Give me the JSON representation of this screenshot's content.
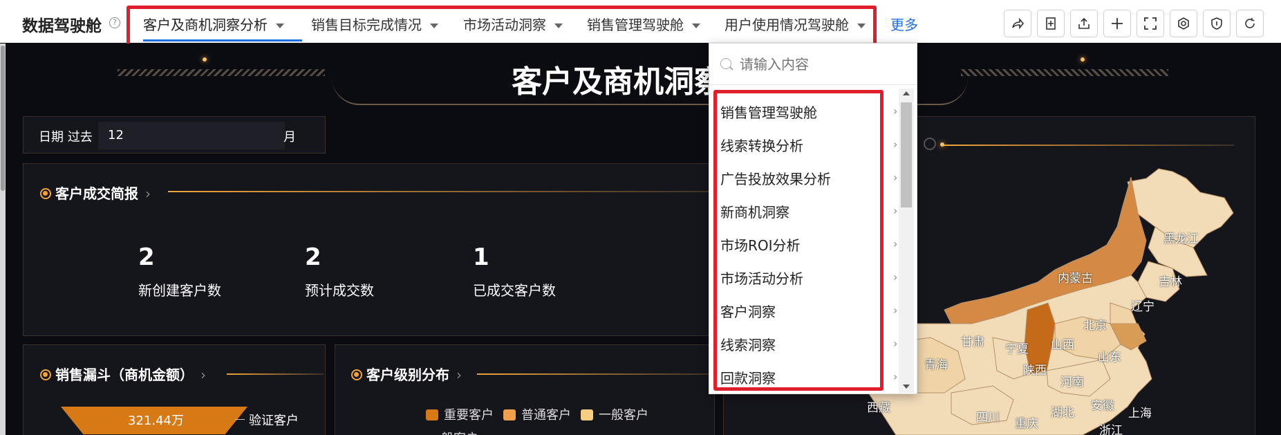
{
  "header": {
    "app_title": "数据驾驶舱",
    "help_glyph": "?",
    "tabs": [
      {
        "label": "客户及商机洞察分析"
      },
      {
        "label": "销售目标完成情况"
      },
      {
        "label": "市场活动洞察"
      },
      {
        "label": "销售管理驾驶舱"
      },
      {
        "label": "用户使用情况驾驶舱"
      }
    ],
    "more_label": "更多",
    "tools": [
      "share-icon",
      "add-page-icon",
      "export-icon",
      "plus-icon",
      "fullscreen-icon",
      "settings-icon",
      "shield-icon",
      "refresh-icon"
    ],
    "accent_color": "#1f6fe5"
  },
  "dashboard": {
    "title": "客户及商机洞察",
    "date_filter": {
      "label": "日期 过去",
      "value": "12",
      "unit": "月"
    },
    "summary": {
      "title": "客户成交简报",
      "kpis": [
        {
          "value": "2",
          "label": "新创建客户数"
        },
        {
          "value": "2",
          "label": "预计成交数"
        },
        {
          "value": "1",
          "label": "已成交客户数"
        }
      ]
    },
    "funnel": {
      "title": "销售漏斗（商机金额）",
      "top_value": "321.44万",
      "top_label": "验证客户"
    },
    "customer_level": {
      "title": "客户级别分布",
      "legend": [
        {
          "name": "重要客户",
          "color": "#d77a16"
        },
        {
          "name": "普通客户",
          "color": "#f0a04b"
        },
        {
          "name": "一般客户",
          "color": "#f5cf7f"
        }
      ],
      "partial_label": "一般客户"
    },
    "map": {
      "provinces": [
        {
          "name": "黑龙江"
        },
        {
          "name": "吉林"
        },
        {
          "name": "辽宁"
        },
        {
          "name": "内蒙古"
        },
        {
          "name": "山西"
        },
        {
          "name": "北京"
        },
        {
          "name": "山东"
        },
        {
          "name": "河南"
        },
        {
          "name": "宁夏"
        },
        {
          "name": "甘肃"
        },
        {
          "name": "陕西"
        },
        {
          "name": "青海"
        },
        {
          "name": "西藏"
        },
        {
          "name": "四川"
        },
        {
          "name": "湖北"
        },
        {
          "name": "安徽"
        },
        {
          "name": "上海"
        },
        {
          "name": "重庆"
        },
        {
          "name": "浙江"
        }
      ]
    }
  },
  "dropdown": {
    "search_placeholder": "请输入内容",
    "items": [
      {
        "label": "销售管理驾驶舱"
      },
      {
        "label": "线索转换分析"
      },
      {
        "label": "广告投放效果分析"
      },
      {
        "label": "新商机洞察"
      },
      {
        "label": "市场ROI分析"
      },
      {
        "label": "市场活动分析"
      },
      {
        "label": "客户洞察"
      },
      {
        "label": "线索洞察"
      },
      {
        "label": "回款洞察"
      }
    ]
  }
}
